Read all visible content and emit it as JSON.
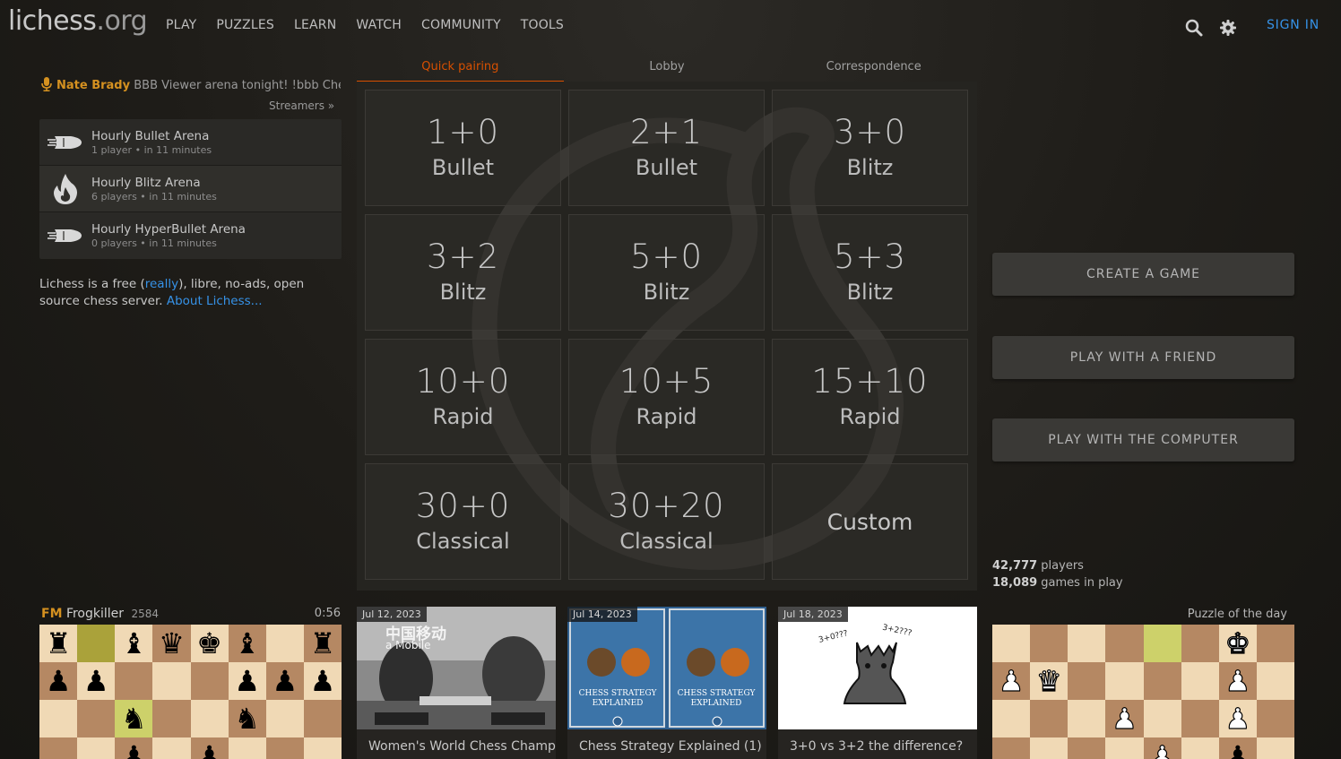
{
  "header": {
    "logo_main": "lichess",
    "logo_tld": ".org",
    "nav": [
      "PLAY",
      "PUZZLES",
      "LEARN",
      "WATCH",
      "COMMUNITY",
      "TOOLS"
    ],
    "sign_in": "SIGN IN",
    "icons": [
      "search-icon",
      "gear-icon"
    ]
  },
  "streamer": {
    "name": "Nate Brady",
    "message": "BBB Viewer arena tonight! !bbb Chess...",
    "streamers_link": "Streamers »"
  },
  "tournaments": [
    {
      "name": "Hourly Bullet Arena",
      "players": "1 player",
      "starts": "in 11 minutes",
      "icon": "bullet-icon"
    },
    {
      "name": "Hourly Blitz Arena",
      "players": "6 players",
      "starts": "in 11 minutes",
      "icon": "blitz-fire-icon"
    },
    {
      "name": "Hourly HyperBullet Arena",
      "players": "0 players",
      "starts": "in 11 minutes",
      "icon": "bullet-icon"
    }
  ],
  "about": {
    "text1": "Lichess is a free (",
    "link1": "really",
    "text2": "), libre, no-ads, open source chess server. ",
    "link2": "About Lichess..."
  },
  "tabs": [
    "Quick pairing",
    "Lobby",
    "Correspondence"
  ],
  "active_tab": "Quick pairing",
  "pool": [
    {
      "clock": "1+0",
      "perf": "Bullet"
    },
    {
      "clock": "2+1",
      "perf": "Bullet"
    },
    {
      "clock": "3+0",
      "perf": "Blitz"
    },
    {
      "clock": "3+2",
      "perf": "Blitz"
    },
    {
      "clock": "5+0",
      "perf": "Blitz"
    },
    {
      "clock": "5+3",
      "perf": "Blitz"
    },
    {
      "clock": "10+0",
      "perf": "Rapid"
    },
    {
      "clock": "10+5",
      "perf": "Rapid"
    },
    {
      "clock": "15+10",
      "perf": "Rapid"
    },
    {
      "clock": "30+0",
      "perf": "Classical"
    },
    {
      "clock": "30+20",
      "perf": "Classical"
    },
    {
      "clock": "",
      "perf": "",
      "custom": "Custom"
    }
  ],
  "buttons": {
    "create": "CREATE A GAME",
    "friend": "PLAY WITH A FRIEND",
    "computer": "PLAY WITH THE COMPUTER"
  },
  "counts": {
    "players_num": "42,777",
    "players_label": " players",
    "games_num": "18,089",
    "games_label": " games in play"
  },
  "tv": {
    "title": "FM",
    "player": "Frogkiller",
    "rating": "2584",
    "clock": "0:56"
  },
  "tv_board": [
    [
      "bR",
      "",
      "bB",
      "bQ",
      "bK",
      "bB",
      "",
      "bR"
    ],
    [
      "bP",
      "bP",
      "",
      "",
      "",
      "bP",
      "bP",
      "bP"
    ],
    [
      "",
      "",
      "bN",
      "",
      "",
      "bN",
      "",
      ""
    ],
    [
      "",
      "",
      "bP",
      "",
      "bP",
      "",
      "",
      ""
    ]
  ],
  "blogs": [
    {
      "date": "Jul 12, 2023",
      "title": "Women's World Chess Championship: Half-way...",
      "banner": "中国移动",
      "banner2": "a Mobile"
    },
    {
      "date": "Jul 14, 2023",
      "title": "Chess Strategy Explained (1)",
      "book": "CHESS STRATEGY EXPLAINED"
    },
    {
      "date": "Jul 18, 2023",
      "title": "3+0 vs 3+2 the difference?",
      "q1": "3+0???",
      "q2": "3+2???"
    }
  ],
  "puzzle": {
    "label": "Puzzle of the day",
    "board": [
      [
        "",
        "",
        "",
        "",
        "",
        "",
        "wK",
        ""
      ],
      [
        "wP",
        "wQ",
        "",
        "",
        "",
        "",
        "wP",
        ""
      ],
      [
        "",
        "",
        "",
        "wP",
        "",
        "",
        "wP",
        ""
      ],
      [
        "",
        "",
        "",
        "",
        "wP",
        "",
        "bP",
        ""
      ]
    ]
  }
}
